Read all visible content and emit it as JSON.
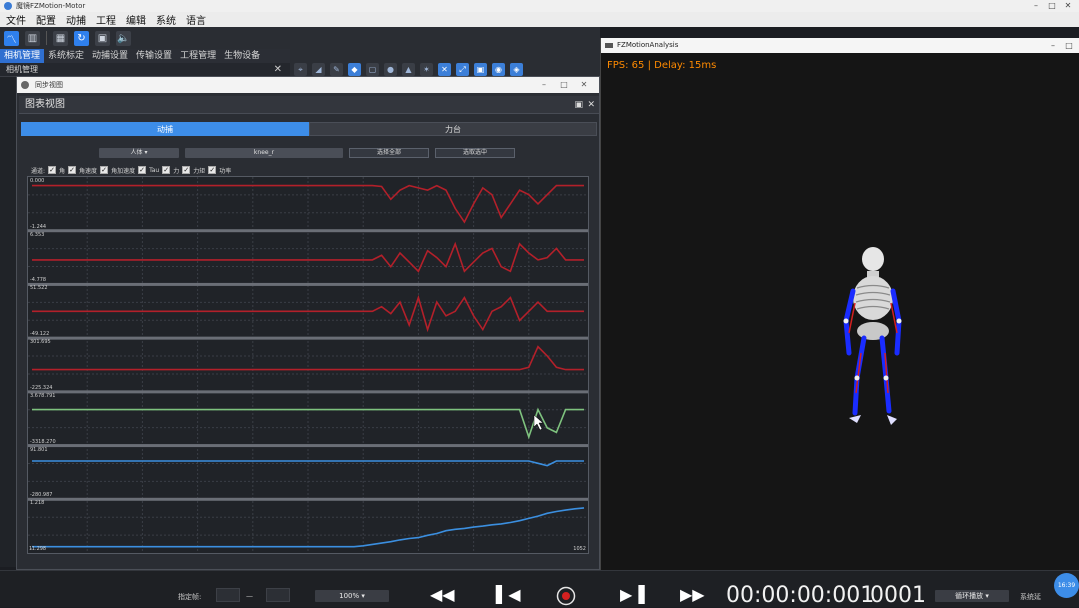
{
  "app": {
    "title": "魔镜FZMotion-Motor",
    "menu": [
      "文件",
      "配置",
      "动捕",
      "工程",
      "编辑",
      "系统",
      "语言"
    ]
  },
  "toolbar": {
    "icons": [
      "chart-icon",
      "factory-icon",
      "grid-icon",
      "refresh-icon",
      "record-icon",
      "volume-icon"
    ]
  },
  "tabs": [
    "相机管理",
    "系统标定",
    "动捕设置",
    "传输设置",
    "工程管理",
    "生物设备"
  ],
  "left_panel": {
    "title": "相机管理"
  },
  "sync_window": {
    "title": "同步视图"
  },
  "chart_window": {
    "title": "图表视图",
    "mode_tabs": [
      {
        "label": "动捕",
        "active": true
      },
      {
        "label": "力台",
        "active": false
      }
    ],
    "body_select": "人体",
    "joint_select": "knee_r",
    "select_all": "选择全部",
    "select_selected": "选取选中",
    "channel_label": "通道:",
    "channels": [
      "角",
      "角速度",
      "角加速度",
      "Tau",
      "力",
      "力矩",
      "功率"
    ],
    "y_labels": [
      "0.000",
      "-1.244",
      "6.353",
      "-4.778",
      "51.522",
      "-49.122",
      "301.695",
      "-225.324",
      "3.678.791",
      "-3318.270",
      "91.801",
      "-280.987",
      "1.218",
      "-1.298"
    ],
    "x_end": "1052"
  },
  "chart_data": {
    "type": "line",
    "rows": 7,
    "samples": 61,
    "x_end": 1052,
    "colors": {
      "red": "#b3202a",
      "green": "#7ec27e",
      "blue": "#3b8fe0"
    },
    "series": [
      {
        "color": "red",
        "values": [
          0.1,
          0.1,
          0.1,
          0.1,
          0.1,
          0.1,
          0.1,
          0.1,
          0.1,
          0.1,
          0.1,
          0.1,
          0.1,
          0.1,
          0.1,
          0.1,
          0.1,
          0.1,
          0.1,
          0.1,
          0.1,
          0.1,
          0.1,
          0.1,
          0.1,
          0.1,
          0.1,
          0.1,
          0.1,
          0.1,
          0.1,
          0.1,
          0.1,
          0.1,
          0.1,
          0.1,
          0.1,
          0.1,
          0.12,
          0.4,
          0.2,
          0.1,
          0.15,
          0.2,
          0.1,
          0.2,
          0.6,
          0.9,
          0.5,
          0.15,
          0.3,
          0.8,
          0.5,
          0.2,
          0.3,
          0.5,
          0.3,
          0.1,
          0.1,
          0.1,
          0.1
        ]
      },
      {
        "color": "red",
        "values": [
          0.55,
          0.55,
          0.55,
          0.55,
          0.55,
          0.55,
          0.55,
          0.55,
          0.55,
          0.55,
          0.55,
          0.55,
          0.55,
          0.55,
          0.55,
          0.55,
          0.55,
          0.55,
          0.55,
          0.55,
          0.55,
          0.55,
          0.55,
          0.55,
          0.55,
          0.55,
          0.55,
          0.55,
          0.55,
          0.55,
          0.55,
          0.55,
          0.55,
          0.55,
          0.55,
          0.55,
          0.55,
          0.55,
          0.45,
          0.7,
          0.4,
          0.6,
          0.8,
          0.35,
          0.5,
          0.7,
          0.2,
          0.8,
          0.6,
          0.4,
          0.3,
          0.7,
          0.8,
          0.2,
          0.4,
          0.55,
          0.5,
          0.3,
          0.55,
          0.55,
          0.55
        ]
      },
      {
        "color": "red",
        "values": [
          0.5,
          0.5,
          0.5,
          0.5,
          0.5,
          0.5,
          0.5,
          0.5,
          0.5,
          0.5,
          0.5,
          0.5,
          0.5,
          0.5,
          0.5,
          0.5,
          0.5,
          0.5,
          0.5,
          0.5,
          0.5,
          0.5,
          0.5,
          0.5,
          0.5,
          0.5,
          0.5,
          0.5,
          0.5,
          0.5,
          0.5,
          0.5,
          0.5,
          0.5,
          0.5,
          0.5,
          0.5,
          0.5,
          0.4,
          0.55,
          0.3,
          0.8,
          0.2,
          0.9,
          0.3,
          0.6,
          0.5,
          0.2,
          0.6,
          0.9,
          0.5,
          0.4,
          0.2,
          0.7,
          0.5,
          0.3,
          0.5,
          0.5,
          0.5,
          0.5,
          0.5
        ]
      },
      {
        "color": "red",
        "values": [
          0.6,
          0.6,
          0.6,
          0.6,
          0.6,
          0.6,
          0.6,
          0.6,
          0.6,
          0.6,
          0.6,
          0.6,
          0.6,
          0.6,
          0.6,
          0.6,
          0.6,
          0.6,
          0.6,
          0.6,
          0.6,
          0.6,
          0.6,
          0.6,
          0.6,
          0.6,
          0.6,
          0.6,
          0.6,
          0.6,
          0.6,
          0.6,
          0.6,
          0.6,
          0.6,
          0.6,
          0.6,
          0.6,
          0.6,
          0.6,
          0.6,
          0.6,
          0.6,
          0.6,
          0.6,
          0.6,
          0.6,
          0.6,
          0.6,
          0.6,
          0.6,
          0.6,
          0.6,
          0.6,
          0.55,
          0.1,
          0.3,
          0.55,
          0.6,
          0.6,
          0.6
        ]
      },
      {
        "color": "green",
        "values": [
          0.3,
          0.3,
          0.3,
          0.3,
          0.3,
          0.3,
          0.3,
          0.3,
          0.3,
          0.3,
          0.3,
          0.3,
          0.3,
          0.3,
          0.3,
          0.3,
          0.3,
          0.3,
          0.3,
          0.3,
          0.3,
          0.3,
          0.3,
          0.3,
          0.3,
          0.3,
          0.3,
          0.3,
          0.3,
          0.3,
          0.3,
          0.3,
          0.3,
          0.3,
          0.3,
          0.3,
          0.3,
          0.3,
          0.3,
          0.3,
          0.3,
          0.3,
          0.3,
          0.3,
          0.3,
          0.3,
          0.3,
          0.3,
          0.3,
          0.3,
          0.3,
          0.3,
          0.3,
          0.3,
          0.9,
          0.3,
          0.7,
          0.8,
          0.3,
          0.3,
          0.3
        ]
      },
      {
        "color": "blue",
        "values": [
          0.25,
          0.25,
          0.25,
          0.25,
          0.25,
          0.25,
          0.25,
          0.25,
          0.25,
          0.25,
          0.25,
          0.25,
          0.25,
          0.25,
          0.25,
          0.25,
          0.25,
          0.25,
          0.25,
          0.25,
          0.25,
          0.25,
          0.25,
          0.25,
          0.25,
          0.25,
          0.25,
          0.25,
          0.25,
          0.25,
          0.25,
          0.25,
          0.25,
          0.25,
          0.25,
          0.25,
          0.25,
          0.25,
          0.25,
          0.25,
          0.25,
          0.25,
          0.25,
          0.25,
          0.25,
          0.25,
          0.25,
          0.25,
          0.25,
          0.25,
          0.25,
          0.25,
          0.25,
          0.25,
          0.25,
          0.3,
          0.35,
          0.25,
          0.25,
          0.25,
          0.25
        ]
      },
      {
        "color": "blue",
        "values": [
          0.95,
          0.95,
          0.95,
          0.95,
          0.95,
          0.95,
          0.95,
          0.95,
          0.95,
          0.95,
          0.95,
          0.95,
          0.95,
          0.95,
          0.95,
          0.95,
          0.95,
          0.95,
          0.95,
          0.95,
          0.95,
          0.95,
          0.95,
          0.95,
          0.95,
          0.95,
          0.95,
          0.95,
          0.95,
          0.95,
          0.95,
          0.95,
          0.95,
          0.95,
          0.95,
          0.95,
          0.93,
          0.9,
          0.87,
          0.84,
          0.8,
          0.77,
          0.75,
          0.7,
          0.66,
          0.6,
          0.57,
          0.55,
          0.52,
          0.5,
          0.47,
          0.45,
          0.42,
          0.38,
          0.33,
          0.28,
          0.22,
          0.18,
          0.15,
          0.12,
          0.1
        ]
      }
    ]
  },
  "analysis_window": {
    "title": "FZMotionAnalysis",
    "fps_text": "FPS: 65 | Delay: 15ms"
  },
  "bottom": {
    "fixed_frame_label": "指定帧:",
    "dash": "—",
    "zoom": "100%",
    "timecode": "00:00:00:001",
    "frame": "0001",
    "loop_mode": "循环播放",
    "sys_label": "系统延",
    "bubble": "16:39"
  }
}
